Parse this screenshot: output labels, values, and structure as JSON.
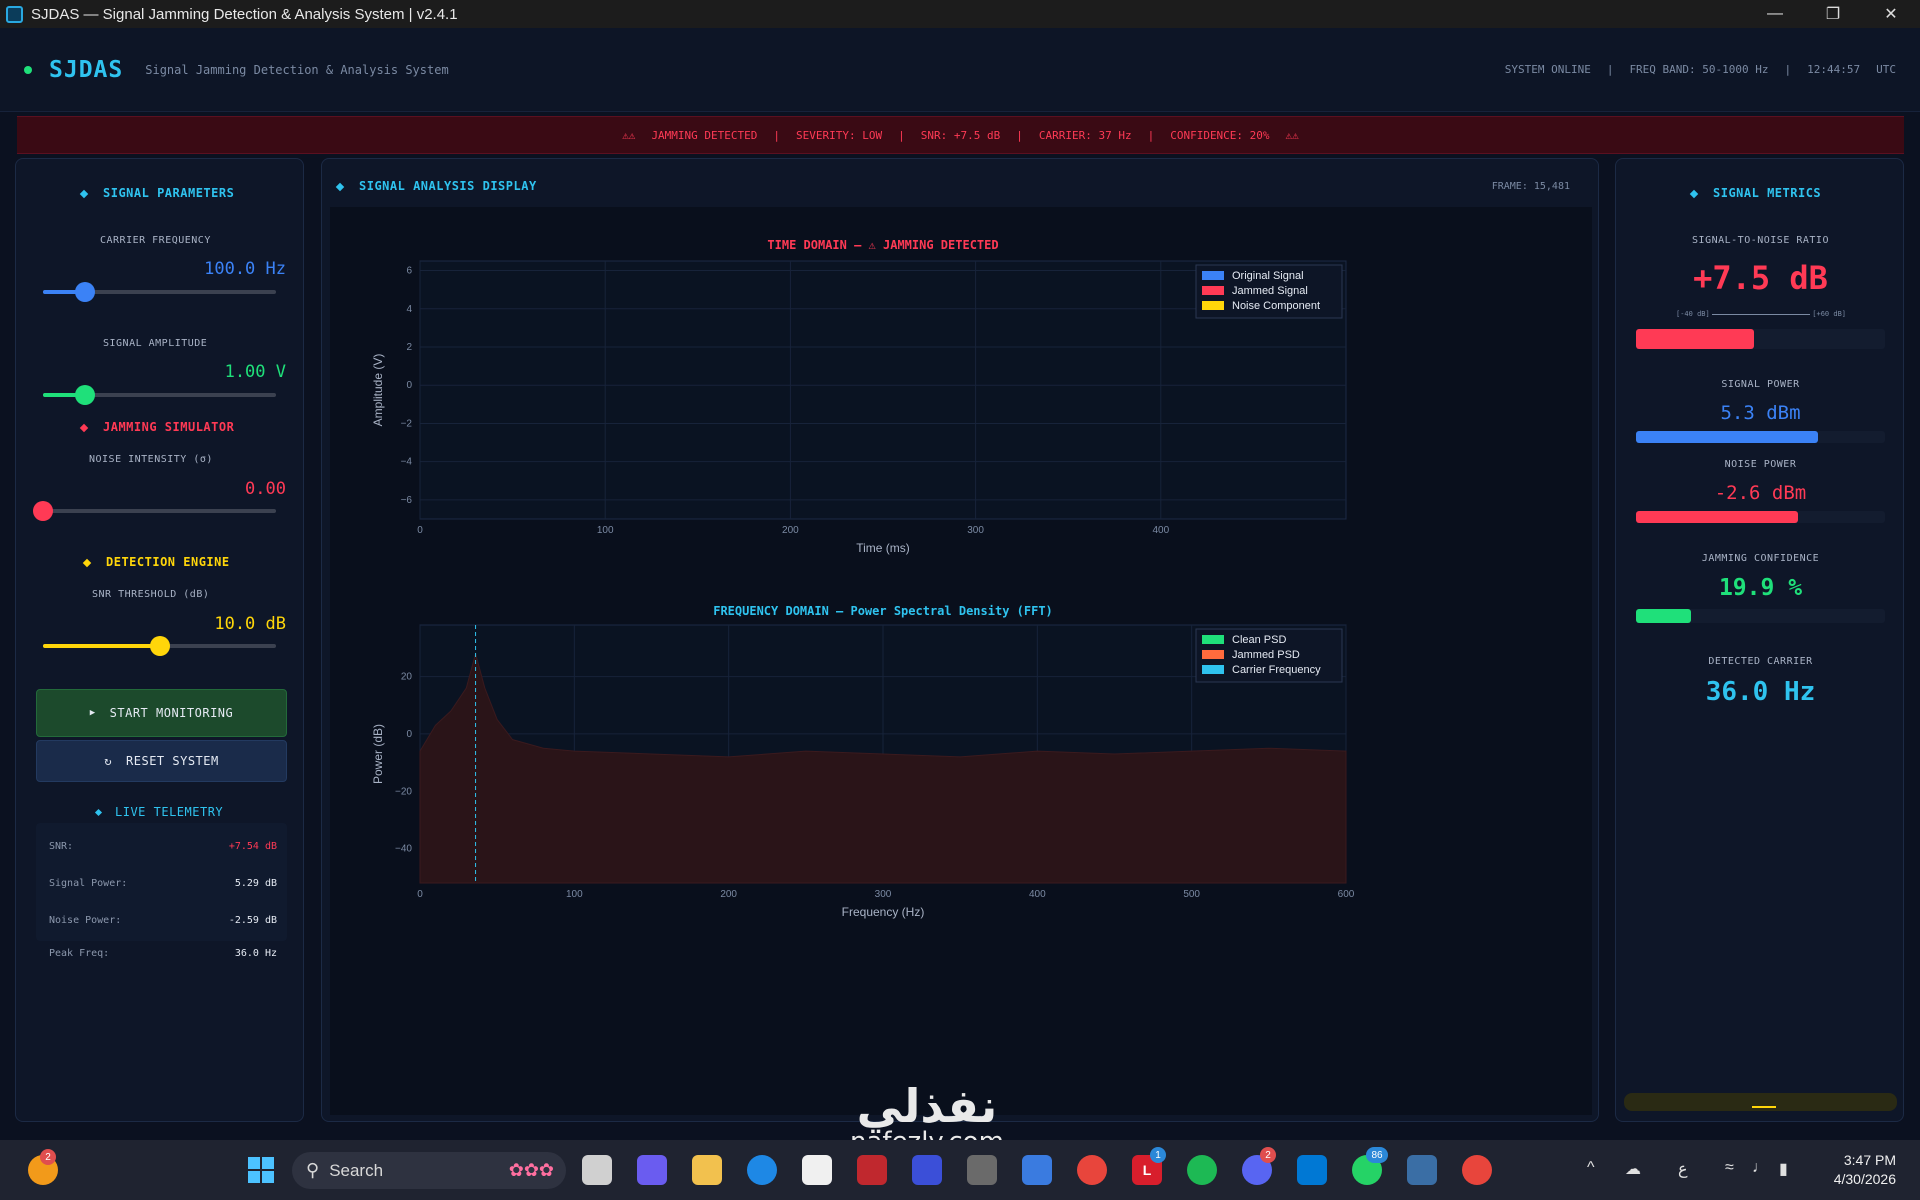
{
  "window": {
    "title": "SJDAS — Signal Jamming Detection & Analysis System  |  v2.4.1",
    "minimize_icon": "minimize-icon",
    "restore_icon": "restore-icon",
    "close_icon": "close-icon"
  },
  "header": {
    "brand": "SJDAS",
    "subtitle": "Signal Jamming Detection & Analysis System",
    "status_online": "SYSTEM ONLINE",
    "freq_band": "FREQ BAND: 50-1000 Hz",
    "time": "12:44:57",
    "tz": "UTC",
    "sep": "|"
  },
  "alert": {
    "icons": "⚠⚠",
    "label": "JAMMING DETECTED",
    "severity": "SEVERITY: LOW",
    "snr": "SNR: +7.5 dB",
    "carrier": "CARRIER: 37 Hz",
    "confidence": "CONFIDENCE: 20%",
    "sep": "|"
  },
  "left": {
    "signal_params_title": "SIGNAL PARAMETERS",
    "carrier_label": "CARRIER FREQUENCY",
    "carrier_value": "100.0 Hz",
    "carrier_level": 0.18,
    "amplitude_label": "SIGNAL AMPLITUDE",
    "amplitude_value": "1.00 V",
    "amplitude_level": 0.18,
    "jamming_title": "JAMMING SIMULATOR",
    "noise_label": "NOISE INTENSITY  (σ)",
    "noise_value": "0.00",
    "noise_level": 0.0,
    "detection_title": "DETECTION ENGINE",
    "snr_label": "SNR THRESHOLD  (dB)",
    "snr_value": "10.0 dB",
    "snr_level": 0.5,
    "start_icon": "▶",
    "start_label": "START MONITORING",
    "reset_icon": "↻",
    "reset_label": "RESET SYSTEM",
    "telemetry_title": "LIVE TELEMETRY",
    "telemetry": [
      {
        "k": "SNR:",
        "v": "+7.54 dB",
        "color": "#ff3a55"
      },
      {
        "k": "Signal Power:",
        "v": "5.29 dB",
        "color": "#e5eaf3"
      },
      {
        "k": "Noise Power:",
        "v": "-2.59 dB",
        "color": "#e5eaf3"
      },
      {
        "k": "Peak Freq:",
        "v": "36.0 Hz",
        "color": "#e5eaf3"
      }
    ]
  },
  "center": {
    "title": "SIGNAL ANALYSIS DISPLAY",
    "frame": "FRAME: 15,481"
  },
  "chart_data": [
    {
      "type": "line",
      "title": "TIME DOMAIN  —  ⚠  JAMMING DETECTED",
      "xlabel": "Time (ms)",
      "ylabel": "Amplitude (V)",
      "xlim": [
        0,
        500
      ],
      "ylim": [
        -7,
        6.5
      ],
      "xticks": [
        0,
        100,
        200,
        300,
        400
      ],
      "yticks": [
        -6,
        -4,
        -2,
        0,
        2,
        4,
        6
      ],
      "grid": true,
      "legend_position": "top-right",
      "series": [
        {
          "name": "Original Signal",
          "color": "#3b82f6",
          "values": []
        },
        {
          "name": "Jammed Signal",
          "color": "#ff3a55",
          "values": []
        },
        {
          "name": "Noise Component",
          "color": "#ffd60a",
          "values": []
        }
      ]
    },
    {
      "type": "area",
      "title": "FREQUENCY DOMAIN  —  Power Spectral Density (FFT)",
      "xlabel": "Frequency (Hz)",
      "ylabel": "Power (dB)",
      "xlim": [
        0,
        600
      ],
      "ylim": [
        -52,
        38
      ],
      "xticks": [
        0,
        100,
        200,
        300,
        400,
        500,
        600
      ],
      "yticks": [
        -40,
        -20,
        0,
        20
      ],
      "grid": true,
      "legend_position": "top-right",
      "carrier_frequency": 36,
      "series": [
        {
          "name": "Clean PSD",
          "color": "#1fe07a",
          "values": []
        },
        {
          "name": "Jammed PSD",
          "color": "#ff6b3d",
          "x": [
            0,
            10,
            20,
            30,
            36,
            42,
            50,
            60,
            80,
            100,
            150,
            200,
            250,
            300,
            350,
            400,
            450,
            500,
            550,
            600
          ],
          "values": [
            -6,
            3,
            8,
            16,
            28,
            16,
            5,
            -2,
            -5,
            -6,
            -7,
            -8,
            -6,
            -7,
            -8,
            -6,
            -7,
            -6,
            -5,
            -6
          ]
        },
        {
          "name": "Carrier Frequency",
          "color": "#2fc3ef",
          "values": []
        }
      ]
    }
  ],
  "right": {
    "title": "SIGNAL METRICS",
    "snr_label": "SIGNAL-TO-NOISE RATIO",
    "snr_value": "+7.5 dB",
    "snr_scale_min": "[-40 dB]",
    "snr_scale_max": "[+60 dB]",
    "snr_level": 0.475,
    "signal_power_label": "SIGNAL POWER",
    "signal_power_value": "5.3 dBm",
    "signal_power_level": 0.73,
    "noise_power_label": "NOISE POWER",
    "noise_power_value": "-2.6 dBm",
    "noise_power_level": 0.65,
    "confidence_label": "JAMMING CONFIDENCE",
    "confidence_value": "19.9 %",
    "confidence_level": 0.22,
    "carrier_label": "DETECTED CARRIER",
    "carrier_value": "36.0 Hz"
  },
  "taskbar": {
    "search_label": "Search",
    "time": "3:47 PM",
    "date": "4/30/2026",
    "lang": "ع",
    "badges": {
      "notif": "2",
      "box": "1",
      "discord": "2",
      "whatsapp": "86"
    }
  },
  "watermark": {
    "arabic": "نفذلي",
    "latin": "nafezly.com"
  },
  "colors": {
    "accent": "#2fc3ef",
    "danger": "#ff3a55",
    "ok": "#1fe07a",
    "warn": "#ffd60a",
    "blue": "#3b82f6"
  }
}
